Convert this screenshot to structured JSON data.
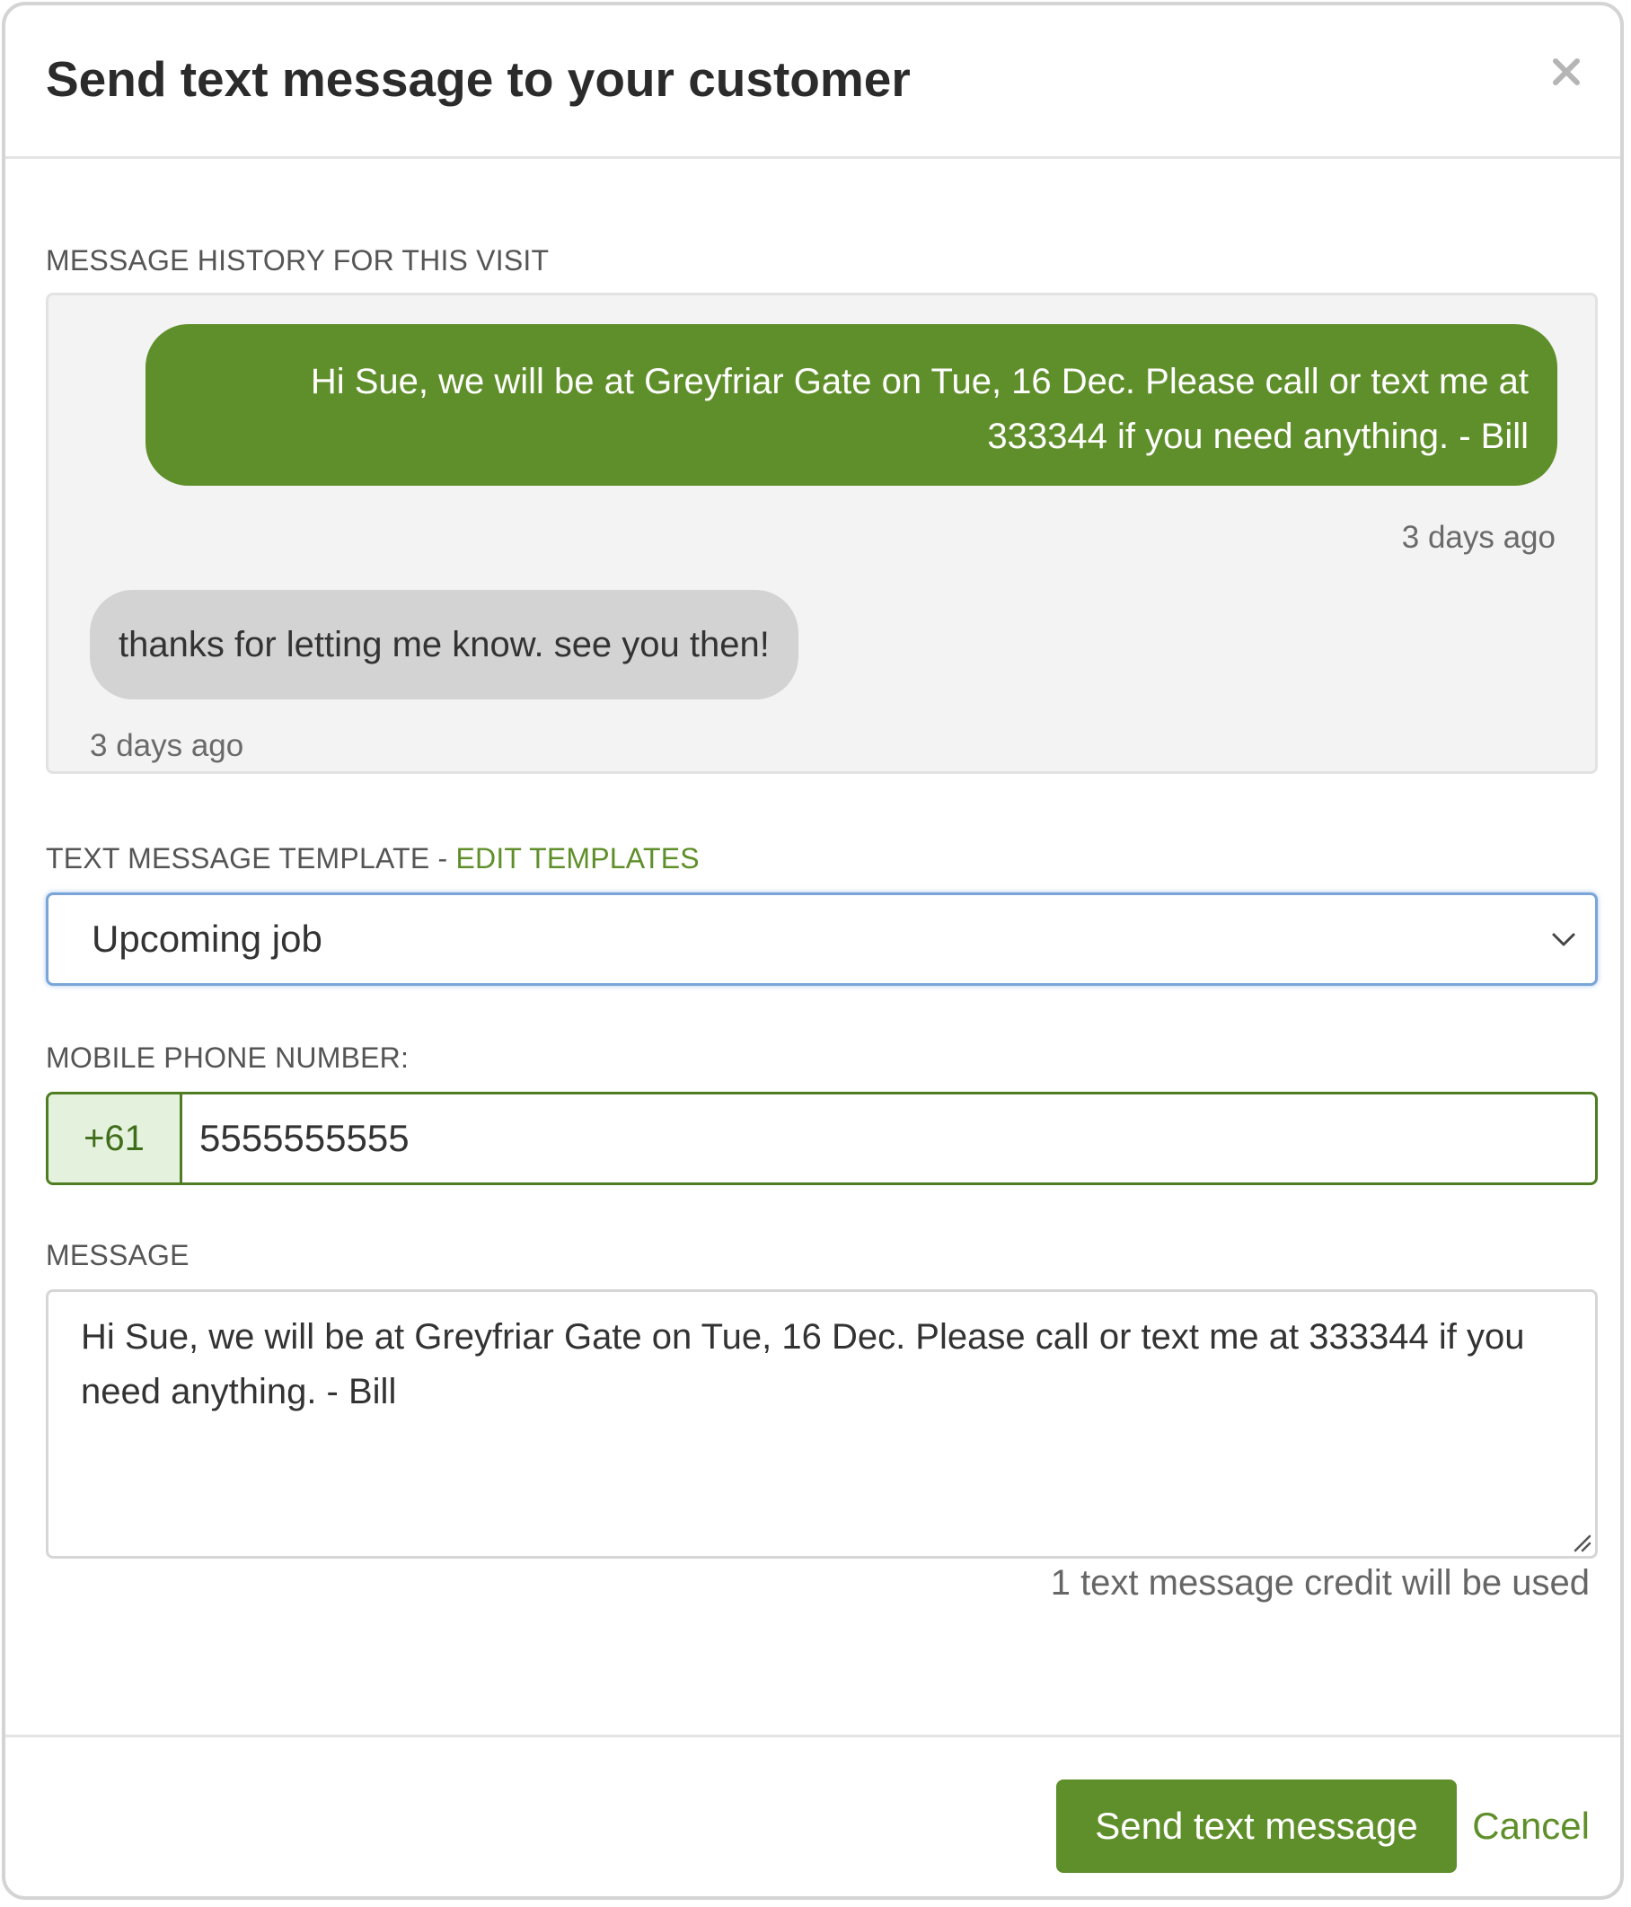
{
  "dialog": {
    "title": "Send text message to your customer",
    "close_icon": "close-icon"
  },
  "history": {
    "label": "MESSAGE HISTORY FOR THIS VISIT",
    "messages": [
      {
        "direction": "outgoing",
        "text": "Hi Sue, we will be at Greyfriar Gate on Tue, 16 Dec. Please call or text me at 333344 if you need anything. - Bill",
        "time": "3 days ago"
      },
      {
        "direction": "incoming",
        "text": "thanks for letting me know. see you then!",
        "time": "3 days ago"
      }
    ]
  },
  "template": {
    "label": "TEXT MESSAGE TEMPLATE - ",
    "edit_link": "EDIT TEMPLATES",
    "selected": "Upcoming job",
    "chevron_icon": "chevron-down-icon"
  },
  "phone": {
    "label": "MOBILE PHONE NUMBER:",
    "country_code": "+61",
    "value": "5555555555"
  },
  "message": {
    "label": "MESSAGE",
    "value": "Hi Sue, we will be at Greyfriar Gate on Tue, 16 Dec. Please call or text me at 333344 if you need anything. - Bill",
    "credit_note": "1 text message credit will be used"
  },
  "actions": {
    "send_label": "Send text message",
    "cancel_label": "Cancel"
  },
  "colors": {
    "accent_green": "#5f8f2a",
    "focus_blue": "#7aa5d8",
    "incoming_bubble": "#d3d3d3",
    "history_bg": "#f3f3f3"
  }
}
